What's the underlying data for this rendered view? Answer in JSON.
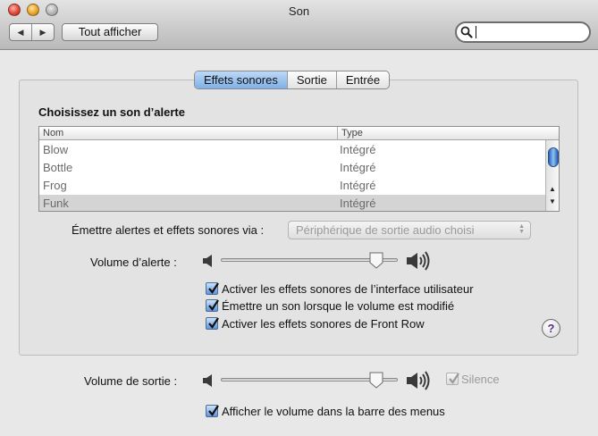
{
  "window": {
    "title": "Son"
  },
  "toolbar": {
    "back_glyph": "◀",
    "forward_glyph": "▶",
    "show_all_label": "Tout afficher",
    "search_placeholder": "",
    "search_value": ""
  },
  "tabs": [
    {
      "label": "Effets sonores",
      "active": true
    },
    {
      "label": "Sortie",
      "active": false
    },
    {
      "label": "Entrée",
      "active": false
    }
  ],
  "effects": {
    "section_title": "Choisissez un son d’alerte",
    "columns": [
      "Nom",
      "Type"
    ],
    "rows": [
      {
        "name": "Blow",
        "type": "Intégré"
      },
      {
        "name": "Bottle",
        "type": "Intégré"
      },
      {
        "name": "Frog",
        "type": "Intégré"
      },
      {
        "name": "Funk",
        "type": "Intégré",
        "selected": true
      }
    ],
    "play_via_label": "Émettre alertes et effets sonores via :",
    "play_via_value": "Périphérique de sortie audio choisi",
    "alert_volume_label": "Volume d’alerte :",
    "alert_volume_level": 0.88,
    "checkboxes": [
      {
        "label": "Activer les effets sonores de l’interface utilisateur",
        "checked": true
      },
      {
        "label": "Émettre un son lorsque le volume est modifié",
        "checked": true
      },
      {
        "label": "Activer les effets sonores de Front Row",
        "checked": true
      }
    ],
    "help_glyph": "?"
  },
  "output": {
    "volume_label": "Volume de sortie :",
    "volume_level": 0.88,
    "mute_label": "Silence",
    "mute_checked": true,
    "mute_enabled": false,
    "menu_bar_label": "Afficher le volume dans la barre des menus",
    "menu_bar_checked": true
  },
  "icons": {
    "volume_low": "speaker-low-icon",
    "volume_high": "speaker-high-icon",
    "search": "search-icon"
  },
  "colors": {
    "accent": "#6fa6e6",
    "checkbox": "#5d95d9",
    "help": "#5b2b8e"
  }
}
